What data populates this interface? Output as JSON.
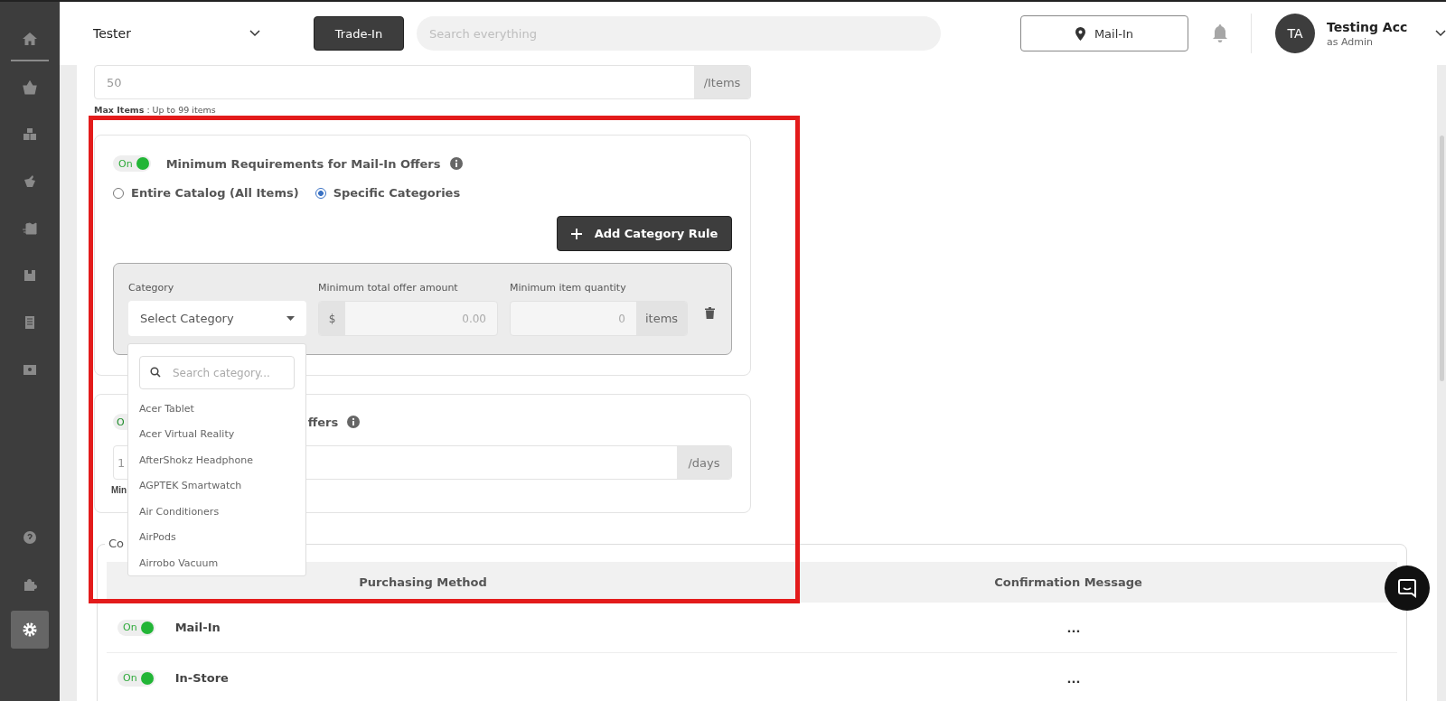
{
  "sidebar": {
    "items": [
      {
        "selected": false
      },
      {
        "selected": false
      },
      {
        "selected": false
      },
      {
        "selected": false
      },
      {
        "selected": false
      },
      {
        "selected": false
      },
      {
        "selected": false
      },
      {
        "selected": false
      }
    ],
    "bottom_items": [
      {
        "selected": false
      },
      {
        "selected": false
      },
      {
        "selected": true
      }
    ]
  },
  "header": {
    "workspace": "Tester",
    "mode_button": "Trade-In",
    "search": {
      "placeholder": "Search everything"
    },
    "location_button": "Mail-In",
    "user": {
      "initials": "TA",
      "name": "Testing Acc",
      "role": "as Admin"
    }
  },
  "max_items": {
    "value": "50",
    "suffix": "/Items",
    "hint": "**Max Items** : Up to 99 items"
  },
  "minimum_requirements": {
    "toggle": {
      "label": "On",
      "on": true
    },
    "title": "Minimum Requirements for Mail-In Offers",
    "scope": [
      {
        "label": "Entire Catalog (All Items)",
        "selected": false
      },
      {
        "label": "Specific Categories",
        "selected": true
      }
    ],
    "add_button": "Add Category Rule",
    "rule": {
      "category_label": "Category",
      "category_placeholder": "Select Category",
      "amount_label": "Minimum total offer amount",
      "amount_prefix": "$",
      "amount_placeholder": "0.00",
      "quantity_label": "Minimum item quantity",
      "quantity_placeholder": "0",
      "quantity_suffix": "items"
    }
  },
  "category_dropdown": {
    "search_placeholder": "Search category...",
    "items": [
      "Acer Tablet",
      "Acer Virtual Reality",
      "AfterShokz Headphone",
      "AGPTEK Smartwatch",
      "Air Conditioners",
      "AirPods",
      "Airrobo Vacuum"
    ]
  },
  "second_card": {
    "toggle": {
      "label": "O",
      "on": true
    },
    "title_fragment": "ffers",
    "value_fragment": "1",
    "suffix": "/days",
    "hint_fragment": "Min"
  },
  "confirmation": {
    "legend_fragment": "Co",
    "columns": [
      "Purchasing Method",
      "Confirmation Message"
    ],
    "rows": [
      {
        "toggle": {
          "label": "On",
          "on": true
        },
        "method": "Mail-In",
        "message": "..."
      },
      {
        "toggle": {
          "label": "On",
          "on": true
        },
        "method": "In-Store",
        "message": "..."
      }
    ]
  }
}
